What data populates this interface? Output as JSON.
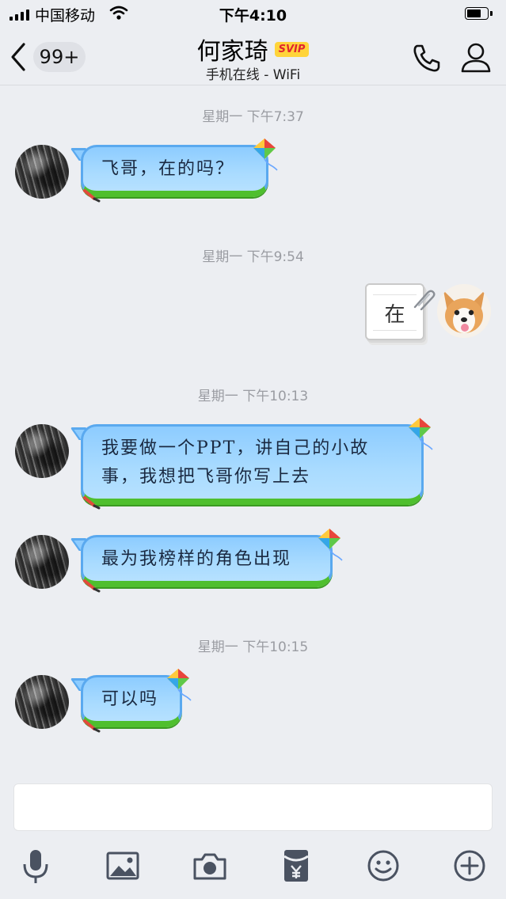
{
  "status_bar": {
    "carrier": "中国移动",
    "time": "下午4:10"
  },
  "nav": {
    "unread_count": "99+",
    "contact_name": "何家琦",
    "vip_badge": "SVIP",
    "online_status": "手机在线 - WiFi"
  },
  "chat": {
    "timestamps": [
      "星期一 下午7:37",
      "星期一 下午9:54",
      "星期一 下午10:13",
      "星期一 下午10:15"
    ],
    "messages": [
      {
        "side": "left",
        "text": "飞哥，在的吗？"
      },
      {
        "side": "right",
        "text": "在"
      },
      {
        "side": "left",
        "lines": [
          "我要做一个PPT，讲自己的小故",
          "事，我想把飞哥你写上去"
        ]
      },
      {
        "side": "left",
        "text": "最为我榜样的角色出现"
      },
      {
        "side": "left",
        "text": "可以吗"
      }
    ]
  },
  "toolbar": {
    "icons": [
      "microphone-icon",
      "image-icon",
      "camera-icon",
      "red-packet-icon",
      "emoji-icon",
      "plus-icon"
    ]
  },
  "colors": {
    "background": "#eceef2",
    "bubble_blue": "#8dccff",
    "bubble_grass": "#4fbf2e",
    "svip_bg": "#ffd43a",
    "svip_text": "#e0262e"
  }
}
